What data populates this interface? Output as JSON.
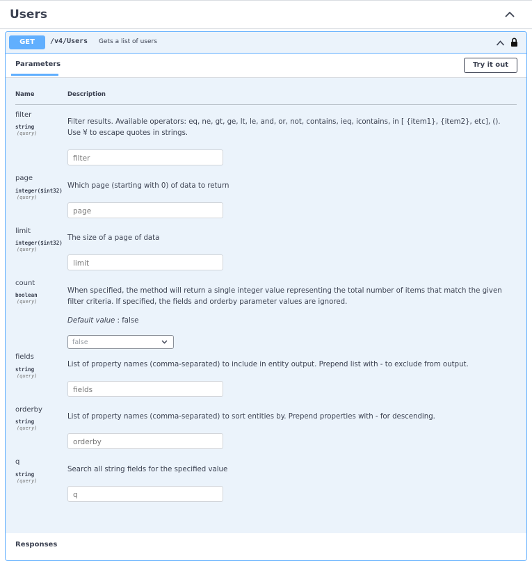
{
  "tag": {
    "title": "Users"
  },
  "operation": {
    "method": "GET",
    "path": "/v4/Users",
    "summary": "Gets a list of users"
  },
  "tabs": {
    "parameters": "Parameters",
    "try_it_out": "Try it out"
  },
  "table": {
    "col_name": "Name",
    "col_description": "Description"
  },
  "parameters": [
    {
      "name": "filter",
      "type": "string",
      "in": "(query)",
      "description_1": "Filter results. Available operators: eq, ne, gt, ge, lt, le, and, or, not, contains, ieq, icontains, in [ {item1}, {item2}, etc], ().",
      "description_2": "Use ¥ to escape quotes in strings.",
      "placeholder": "filter"
    },
    {
      "name": "page",
      "type": "integer($int32)",
      "in": "(query)",
      "description": "Which page (starting with 0) of data to return",
      "placeholder": "page"
    },
    {
      "name": "limit",
      "type": "integer($int32)",
      "in": "(query)",
      "description": "The size of a page of data",
      "placeholder": "limit"
    },
    {
      "name": "count",
      "type": "boolean",
      "in": "(query)",
      "description_1": "When specified, the method will return a single integer value representing the total number of items that match the given",
      "description_2": "filter criteria. If specified, the fields and orderby parameter values are ignored.",
      "default_label": "Default value",
      "default_value": ": false",
      "selected": "false"
    },
    {
      "name": "fields",
      "type": "string",
      "in": "(query)",
      "description": "List of property names (comma-separated) to include in entity output. Prepend list with - to exclude from output.",
      "placeholder": "fields"
    },
    {
      "name": "orderby",
      "type": "string",
      "in": "(query)",
      "description": "List of property names (comma-separated) to sort entities by. Prepend properties with - for descending.",
      "placeholder": "orderby"
    },
    {
      "name": "q",
      "type": "string",
      "in": "(query)",
      "description": "Search all string fields for the specified value",
      "placeholder": "q"
    }
  ],
  "responses": {
    "title": "Responses"
  },
  "colors": {
    "get_accent": "#61affe",
    "panel_bg": "#ebf3fb",
    "text": "#3b4151"
  },
  "icons": {
    "tag_toggle": "chevron-up-icon",
    "op_toggle": "chevron-up-icon",
    "auth": "lock-icon",
    "select": "chevron-down-icon"
  }
}
